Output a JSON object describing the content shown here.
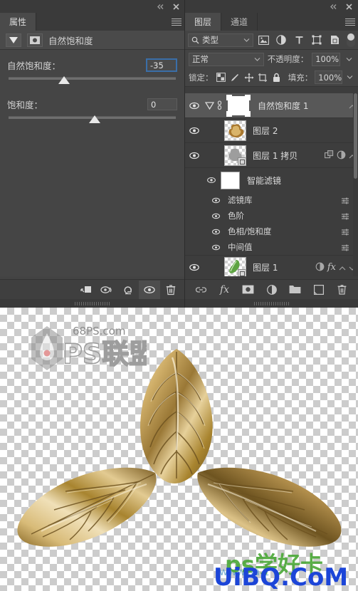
{
  "app": {
    "name": "Photoshop"
  },
  "properties_panel": {
    "topbar": {
      "collapse_icon": "collapse-double-arrow-icon",
      "close_icon": "close-icon"
    },
    "tabs": [
      {
        "label": "属性",
        "active": true
      }
    ],
    "menu_icon": "panel-menu-icon",
    "header": {
      "adjustment_icon": "vibrance-adjustment-icon",
      "mask_icon": "layer-mask-icon",
      "title": "自然饱和度"
    },
    "controls": [
      {
        "label": "自然饱和度：",
        "value": "-35",
        "focused": true,
        "thumb_percent": 37
      },
      {
        "label": "饱和度：",
        "value": "0",
        "focused": false,
        "thumb_percent": 50
      }
    ],
    "footer_buttons": [
      {
        "name": "clip-to-layer-icon",
        "active": false
      },
      {
        "name": "view-previous-state-icon",
        "active": false
      },
      {
        "name": "reset-icon",
        "active": false
      },
      {
        "name": "toggle-visibility-icon",
        "active": true
      },
      {
        "name": "delete-icon",
        "active": false
      }
    ]
  },
  "layers_panel": {
    "topbar": {
      "collapse_icon": "collapse-double-arrow-icon",
      "close_icon": "close-icon"
    },
    "tabs": [
      {
        "label": "图层",
        "active": true
      },
      {
        "label": "通道",
        "active": false
      }
    ],
    "menu_icon": "panel-menu-icon",
    "filter": {
      "search_icon": "search-icon",
      "kind_label": "类型",
      "caret_icon": "chevron-down-icon",
      "type_icons": [
        "pixel-layer-filter-icon",
        "adjustment-layer-filter-icon",
        "type-layer-filter-icon",
        "shape-layer-filter-icon",
        "smart-object-filter-icon"
      ],
      "toggle_icon": "filter-enable-toggle"
    },
    "blend": {
      "mode": "正常",
      "mode_caret": "chevron-down-icon",
      "opacity_label": "不透明度：",
      "opacity_value": "100%",
      "opacity_caret": "chevron-down-icon"
    },
    "lock": {
      "label": "锁定：",
      "icons": [
        "lock-transparent-pixels-icon",
        "lock-image-pixels-icon",
        "lock-position-icon",
        "lock-artboard-nesting-icon",
        "lock-all-icon"
      ],
      "fill_label": "填充：",
      "fill_value": "100%",
      "fill_caret": "chevron-down-icon"
    },
    "layers": [
      {
        "type": "adjustment",
        "name": "自然饱和度 1",
        "visible": true,
        "selected": true,
        "has_caret": true,
        "link_icon": "mask-link-icon",
        "thumb": "white-mask",
        "expand_icon": "chevron-up-icon"
      },
      {
        "type": "pixel",
        "name": "图层 2",
        "visible": true,
        "selected": false,
        "thumb": "gold-leaf"
      },
      {
        "type": "smart-object",
        "name": "图层 1 拷贝",
        "visible": true,
        "selected": false,
        "thumb": "gray-leaf",
        "right_icons": [
          "smart-object-badge-icon",
          "filter-effects-icon",
          "chevron-up-icon"
        ]
      },
      {
        "type": "smart-filter-group",
        "name": "智能滤镜",
        "visible": true,
        "thumb": "white-mask",
        "filters": [
          {
            "name": "滤镜库",
            "visible": true,
            "options_icon": "filter-options-icon"
          },
          {
            "name": "色阶",
            "visible": true,
            "options_icon": "filter-options-icon"
          },
          {
            "name": "色相/饱和度",
            "visible": true,
            "options_icon": "filter-options-icon"
          },
          {
            "name": "中间值",
            "visible": true,
            "options_icon": "filter-options-icon"
          }
        ]
      },
      {
        "type": "smart-object",
        "name": "图层 1",
        "visible": true,
        "selected": false,
        "thumb": "green-leaf",
        "right_icons": [
          "adjustment-badge-icon",
          "fx-icon",
          "chevron-up-icon",
          "chevron-down-icon"
        ]
      }
    ],
    "footer_buttons": [
      "link-layers-icon",
      "add-layer-style-icon",
      "add-layer-mask-icon",
      "new-adjustment-layer-icon",
      "new-group-icon",
      "new-layer-icon",
      "delete-layer-icon"
    ]
  },
  "canvas": {
    "watermark_logo_text": "68PS.com",
    "watermark_logo_sub": "PS联盟",
    "watermark_bottom": "UiBQ.CoM",
    "watermark_bottom_green": "ps学好卡",
    "watermark_bottom_small": "www.sa.z"
  }
}
